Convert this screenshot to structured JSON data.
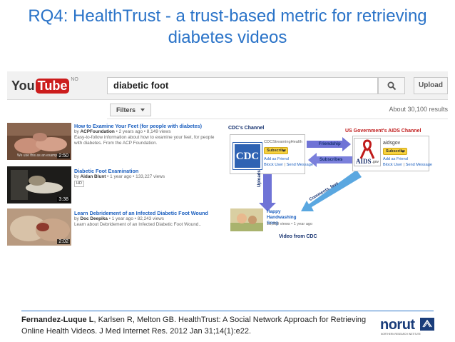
{
  "slide": {
    "title_line1": "RQ4: HealthTrust - a trust-based metric for retrieving",
    "title_line2": "diabetes videos"
  },
  "youtube": {
    "logo_you": "You",
    "logo_tube": "Tube",
    "region": "NO",
    "search_value": "diabetic foot",
    "upload_label": "Upload",
    "filters_label": "Filters",
    "result_count": "About 30,100 results"
  },
  "results": [
    {
      "title": "How to Examine Your Feet (for people with diabetes)",
      "by": "by",
      "channel": "ACPFoundation",
      "meta": "• 2 years ago • 8,149 views",
      "description": "Easy-to-follow information about how to examine your feet, for people with diabetes. From the ACP Foundation.",
      "duration": "2:50",
      "caption": "We use this as an example"
    },
    {
      "title": "Diabetic Foot Examination",
      "by": "by",
      "channel": "Aidan Blunt",
      "meta": "• 1 year ago • 133,227 views",
      "badge": "HD",
      "duration": "3:38"
    },
    {
      "title": "Learn Debridement of an Infected Diabetic Foot Wound",
      "by": "by",
      "channel": "Doc Deepika",
      "meta": "• 1 year ago • 82,243 views",
      "description": "Learn about Debridement of an Infected Diabetic Foot Wound..",
      "duration": "2:02"
    }
  ],
  "diagram": {
    "cdc_channel_label": "CDC's Channel",
    "cdc_logo": "CDC",
    "cdc_channel_name": "CDCStreamingHealth",
    "subscribe_label": "Subscribe",
    "add_friend": "Add as Friend",
    "block_user": "Block User",
    "send_message": "Send Message",
    "aids_channel_label": "US Government's AIDS Channel",
    "aids_channel_name": "aidsgov",
    "aids_logo": "AIDS",
    "aids_gov": ".gov",
    "friendship": "Friendship",
    "subscribes": "Subscribes",
    "uploads": "Uploads",
    "comments_favs": "Comments, favs",
    "video_title": "Happy Handwashing Song",
    "video_meta": "13,350 views • 1 year ago",
    "video_from": "Video from CDC",
    "colors": {
      "arrow_purple": "#6f73d6",
      "arrow_blue": "#5aa7e0",
      "title_blue": "#2a73c8",
      "red": "#c01b1b"
    }
  },
  "footer": {
    "author_bold": "Fernandez-Luque L",
    "citation_rest": ", Karlsen R, Melton GB. HealthTrust: A Social Network Approach for Retrieving Online Health Videos. J Med Internet Res. 2012 Jan 31;14(1):e22.",
    "logo_text": "norut",
    "logo_tagline": "NORTHERN RESEARCH INSTITUTE"
  }
}
